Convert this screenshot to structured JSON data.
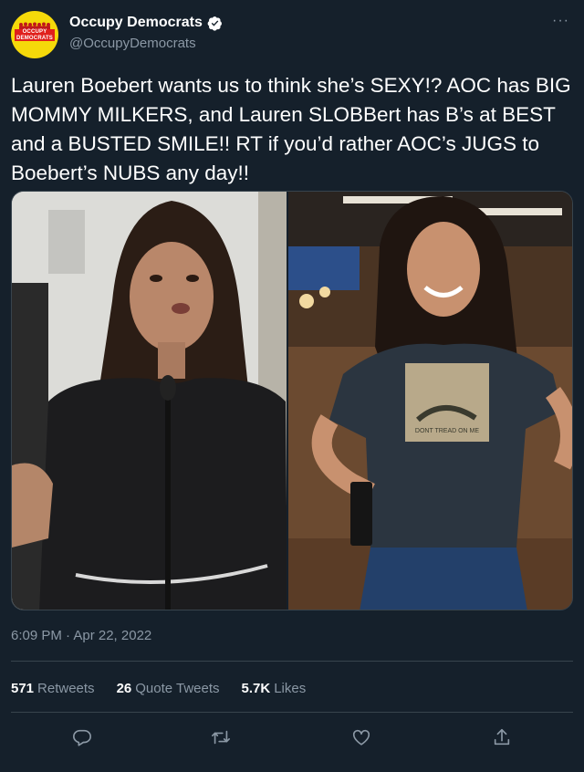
{
  "account": {
    "display_name": "Occupy Democrats",
    "handle": "@OccupyDemocrats",
    "avatar_text_line1": "OCCUPY",
    "avatar_text_line2": "DEMOCRATS",
    "verified": true
  },
  "tweet": {
    "text": "Lauren Boebert wants us to think she’s SEXY!? AOC has BIG MOMMY MILKERS, and Lauren SLOBBert has B’s at BEST and a BUSTED SMILE!! RT if you’d rather AOC’s JUGS to Boebert’s NUBS any day!!",
    "timestamp": "6:09 PM · Apr 22, 2022",
    "shirt_text": "DONT TREAD ON ME"
  },
  "stats": {
    "retweets_count": "571",
    "retweets_label": "Retweets",
    "quotes_count": "26",
    "quotes_label": "Quote Tweets",
    "likes_count": "5.7K",
    "likes_label": "Likes"
  },
  "icons": {
    "more": "more-icon",
    "verified": "verified-icon",
    "reply": "reply-icon",
    "retweet": "retweet-icon",
    "like": "like-icon",
    "share": "share-icon"
  },
  "colors": {
    "background": "#15202b",
    "secondary_text": "#8b98a5",
    "border": "#38444d",
    "avatar_yellow": "#f5d90a",
    "avatar_red": "#e0201c"
  }
}
